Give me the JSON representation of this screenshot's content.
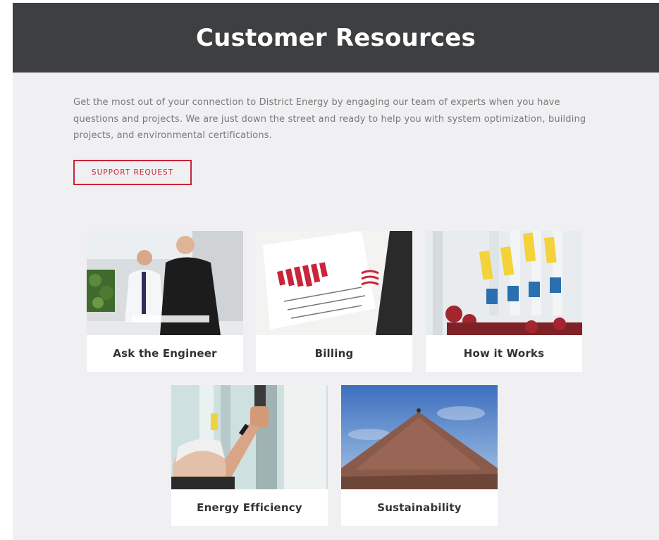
{
  "header": {
    "title": "Customer Resources"
  },
  "intro": {
    "text": "Get the most out of your connection to District Energy by engaging our team of experts when you have questions and projects. We are just down the street and ready to help you with system optimization, building projects, and environmental certifications."
  },
  "support_button": {
    "label": "SUPPORT REQUEST"
  },
  "cards": [
    {
      "label": "Ask the Engineer"
    },
    {
      "label": "Billing"
    },
    {
      "label": "How it Works"
    },
    {
      "label": "Energy Efficiency"
    },
    {
      "label": "Sustainability"
    }
  ],
  "colors": {
    "hero_bg": "#3e3f41",
    "page_bg": "#f0f0f2",
    "accent": "#c8253b",
    "card_bg": "#ffffff"
  }
}
